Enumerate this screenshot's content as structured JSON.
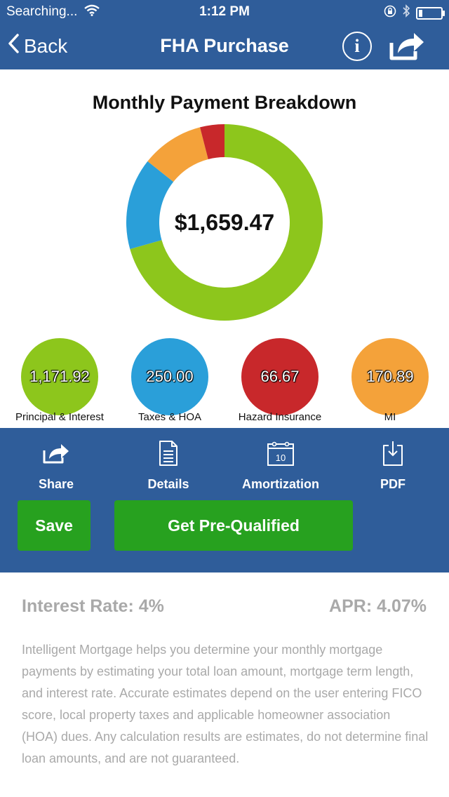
{
  "status_bar": {
    "carrier": "Searching...",
    "time": "1:12 PM"
  },
  "nav": {
    "back_label": "Back",
    "title": "FHA Purchase",
    "info_glyph": "i"
  },
  "chart_title": "Monthly Payment Breakdown",
  "chart_data": {
    "type": "pie",
    "center_label": "$1,659.47",
    "series": [
      {
        "name": "Principal & Interest",
        "value": 1171.92,
        "label": "1,171.92",
        "color": "#8dc61c"
      },
      {
        "name": "Taxes & HOA",
        "value": 250.0,
        "label": "250.00",
        "color": "#2a9fd9"
      },
      {
        "name": "Hazard Insurance",
        "value": 66.67,
        "label": "66.67",
        "color": "#c8282b"
      },
      {
        "name": "MI",
        "value": 170.89,
        "label": "170.89",
        "color": "#f4a23a"
      }
    ],
    "slice_order": [
      0,
      1,
      3,
      2
    ]
  },
  "actions": [
    {
      "label": "Share",
      "icon": "share-icon"
    },
    {
      "label": "Details",
      "icon": "document-icon"
    },
    {
      "label": "Amortization",
      "icon": "calendar-icon",
      "icon_text": "10"
    },
    {
      "label": "PDF",
      "icon": "download-icon"
    }
  ],
  "buttons": {
    "save": "Save",
    "prequalify": "Get Pre-Qualified"
  },
  "rates": {
    "interest": "Interest Rate: 4%",
    "apr": "APR: 4.07%"
  },
  "disclaimer": "Intelligent Mortgage helps you determine your monthly mortgage payments by estimating your total loan amount, mortgage term length, and interest rate. Accurate estimates depend on the user entering FICO score, local property taxes and applicable homeowner association (HOA) dues. Any calculation results are estimates, do not determine final loan amounts, and are not guaranteed.",
  "colors": {
    "brand_blue": "#2f5d9a",
    "button_green": "#27a11f",
    "muted_text": "#a9a9a9"
  }
}
